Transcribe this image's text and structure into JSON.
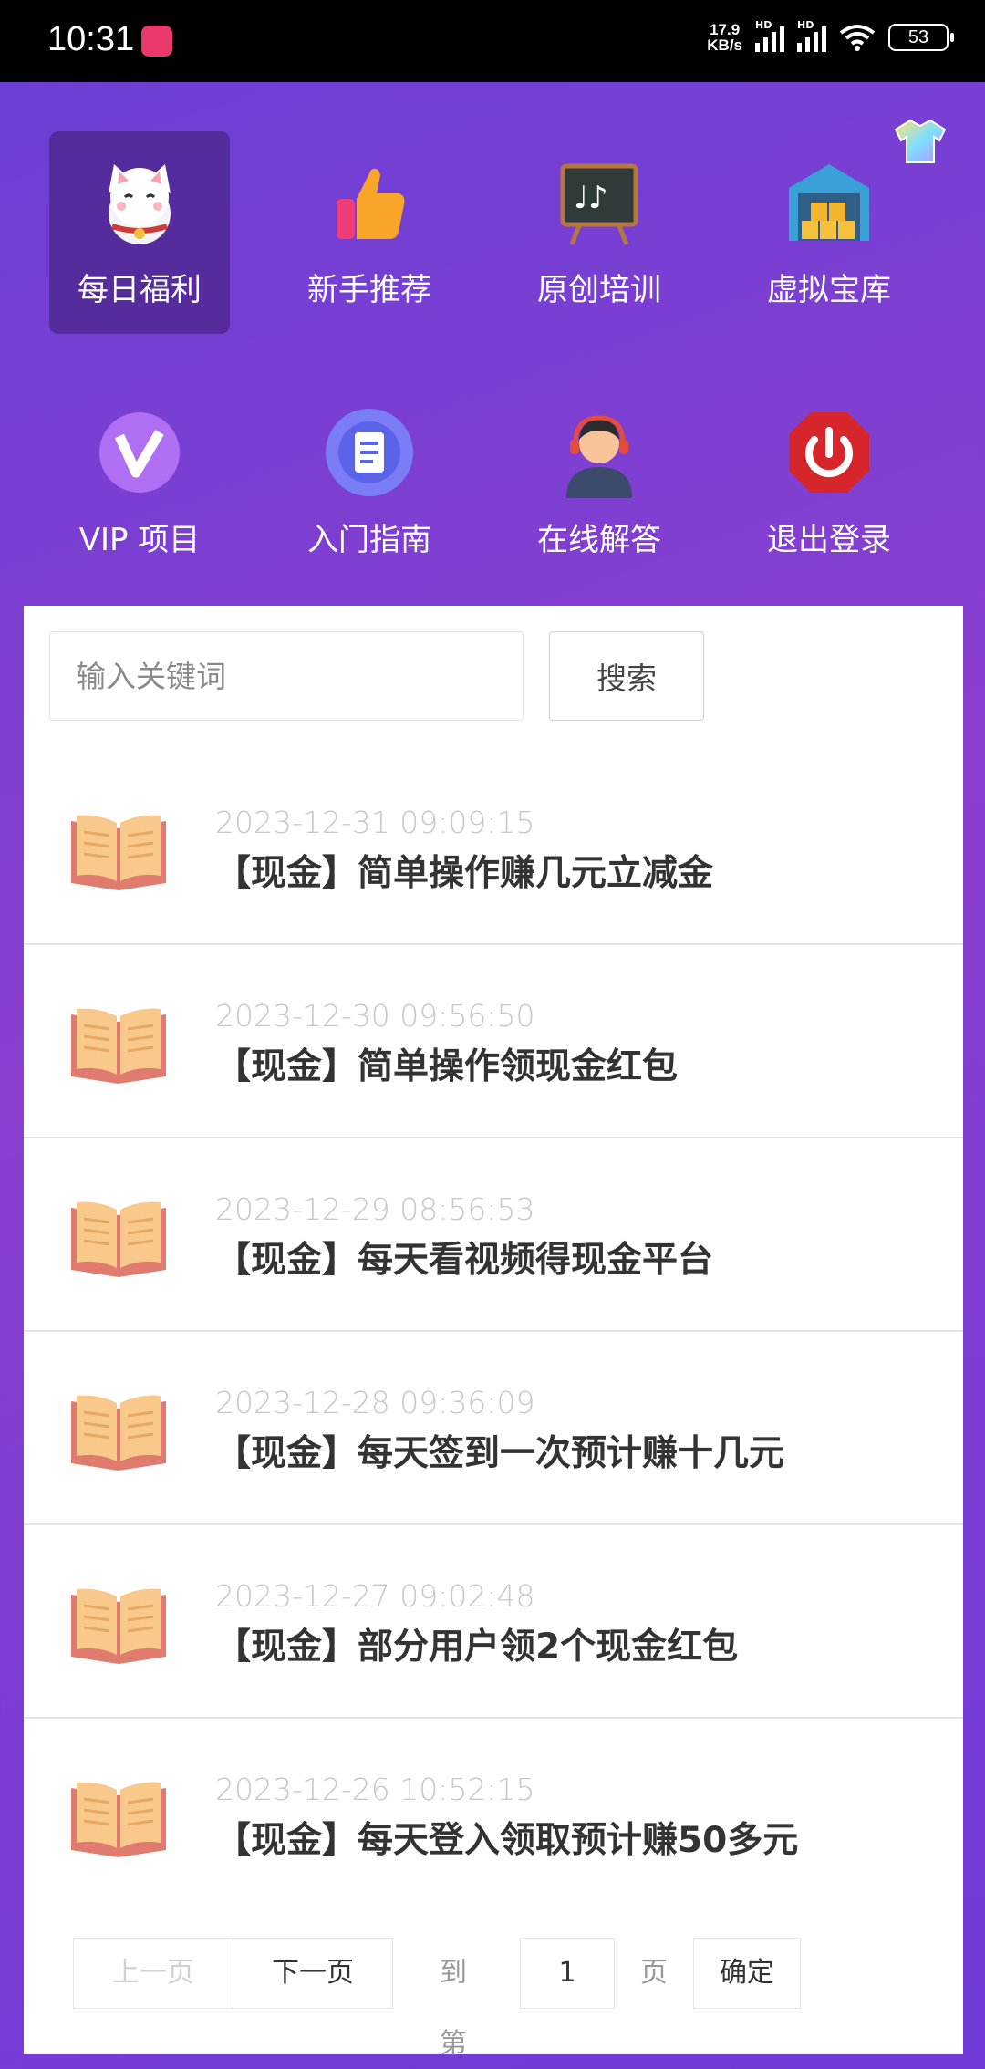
{
  "status_bar": {
    "time": "10:31",
    "net_speed_value": "17.9",
    "net_speed_unit": "KB/s",
    "signal_label_1": "HD",
    "signal_label_2": "HD",
    "battery": "53"
  },
  "menu": [
    {
      "label": "每日福利",
      "icon": "lucky-cat-icon"
    },
    {
      "label": "新手推荐",
      "icon": "thumbs-up-icon"
    },
    {
      "label": "原创培训",
      "icon": "music-blackboard-icon"
    },
    {
      "label": "虚拟宝库",
      "icon": "warehouse-icon"
    },
    {
      "label": "VIP 项目",
      "icon": "vip-icon"
    },
    {
      "label": "入门指南",
      "icon": "document-icon"
    },
    {
      "label": "在线解答",
      "icon": "customer-service-icon"
    },
    {
      "label": "退出登录",
      "icon": "power-icon"
    }
  ],
  "search": {
    "placeholder": "输入关键词",
    "button_label": "搜索"
  },
  "articles": [
    {
      "date": "2023-12-31 09:09:15",
      "title": "【现金】简单操作赚几元立减金"
    },
    {
      "date": "2023-12-30 09:56:50",
      "title": "【现金】简单操作领现金红包"
    },
    {
      "date": "2023-12-29 08:56:53",
      "title": "【现金】每天看视频得现金平台"
    },
    {
      "date": "2023-12-28 09:36:09",
      "title": "【现金】每天签到一次预计赚十几元"
    },
    {
      "date": "2023-12-27 09:02:48",
      "title": "【现金】部分用户领2个现金红包"
    },
    {
      "date": "2023-12-26 10:52:15",
      "title": "【现金】每天登入领取预计赚50多元"
    }
  ],
  "pagination": {
    "prev_label": "上一页",
    "next_label": "下一页",
    "goto_prefix": "到第",
    "page_value": "1",
    "goto_suffix": "页",
    "confirm_label": "确定"
  },
  "colors": {
    "background_start": "#6a3fd6",
    "background_mid": "#8a3fcf",
    "book_cover": "#e07b6f",
    "book_pages": "#f8c98a"
  }
}
